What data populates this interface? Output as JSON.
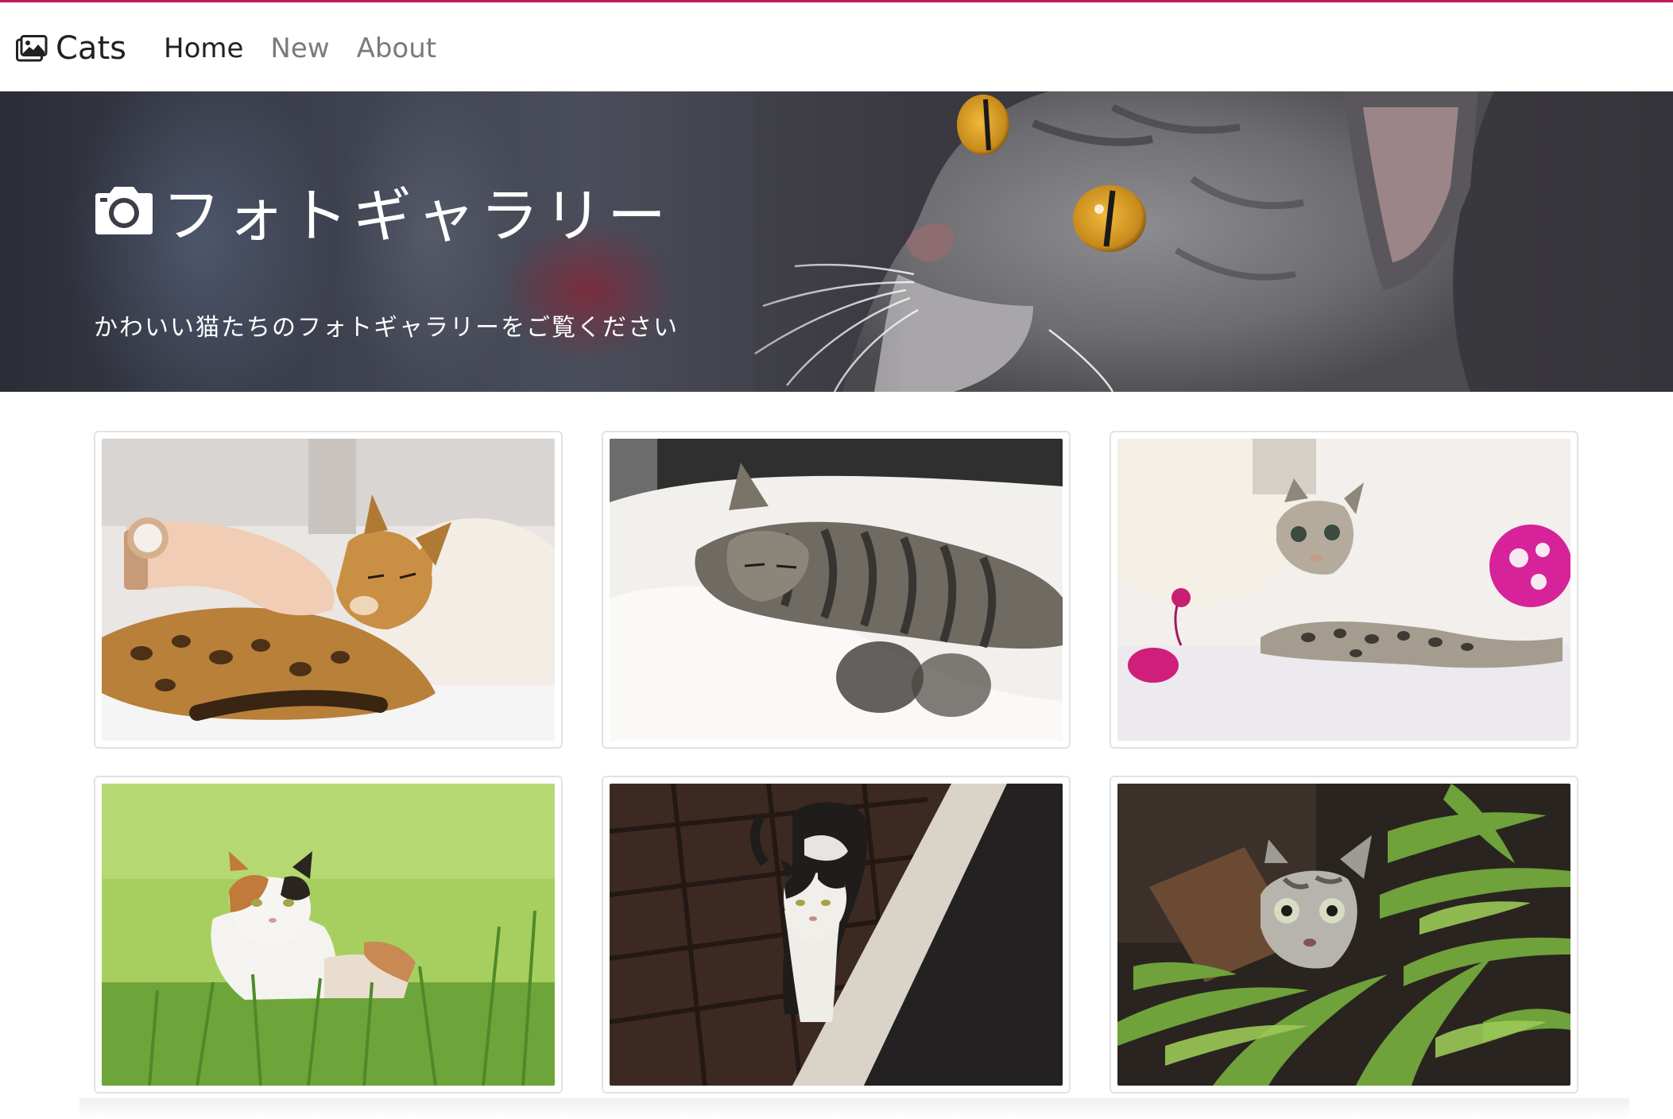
{
  "navbar": {
    "brand": {
      "icon": "image-icon",
      "label": "Cats"
    },
    "links": [
      {
        "label": "Home",
        "active": true
      },
      {
        "label": "New",
        "active": false
      },
      {
        "label": "About",
        "active": false
      }
    ],
    "accent_color": "#c2185b"
  },
  "hero": {
    "icon": "camera-icon",
    "title": "フォトギャラリー",
    "subtitle": "かわいい猫たちのフォトギャラリーをご覧ください"
  },
  "gallery": {
    "photos": [
      {
        "subject": "bengal-cat-petted-by-hand"
      },
      {
        "subject": "tabby-cat-sleeping-in-bed"
      },
      {
        "subject": "kitten-with-toy-ball-and-mouse"
      },
      {
        "subject": "calico-cat-in-grass"
      },
      {
        "subject": "black-and-white-cat-on-brick-path"
      },
      {
        "subject": "silver-tabby-cat-in-bamboo-leaves"
      }
    ]
  }
}
